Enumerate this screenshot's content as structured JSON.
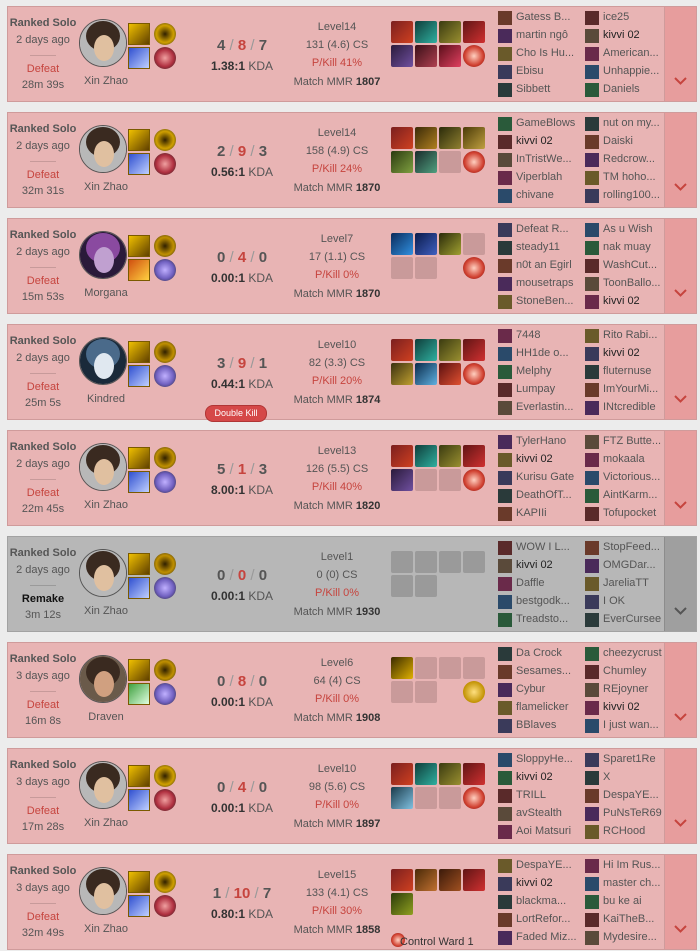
{
  "matches": [
    {
      "game_type": "Ranked Solo",
      "time_ago": "2 days ago",
      "result": "Defeat",
      "length": "28m 39s",
      "champion": "Xin Zhao",
      "portrait": "xin",
      "spells": [
        "smite-icon",
        "flash-icon"
      ],
      "runes": [
        "electrocute-rune-icon",
        "domination-rune-icon"
      ],
      "kda": {
        "k": "4",
        "d": "8",
        "a": "7"
      },
      "kda_ratio": "1.38:1",
      "level": "Level14",
      "cs": "131 (4.6) CS",
      "pkill": "P/Kill 41%",
      "mmr_label": "Match MMR",
      "mmr": "1807",
      "items": [
        "i1",
        "i2",
        "i3",
        "i4",
        "i5",
        "i6",
        "i7"
      ],
      "items_empty": 0,
      "ward": "red",
      "ward_label": "",
      "badge": "",
      "team1": [
        "Gatess B...",
        "martin ngô",
        "Cho Is Hu...",
        "Ebisu",
        "Sibbett"
      ],
      "team2": [
        "ice25",
        "kivvi 02",
        "American...",
        "Unhappie...",
        "Daniels"
      ],
      "me_team": 2,
      "me_index": 1
    },
    {
      "game_type": "Ranked Solo",
      "time_ago": "2 days ago",
      "result": "Defeat",
      "length": "32m 31s",
      "champion": "Xin Zhao",
      "portrait": "xin",
      "spells": [
        "smite-icon",
        "flash-icon"
      ],
      "runes": [
        "electrocute-rune-icon",
        "domination-rune-icon"
      ],
      "kda": {
        "k": "2",
        "d": "9",
        "a": "3"
      },
      "kda_ratio": "0.56:1",
      "level": "Level14",
      "cs": "158 (4.9) CS",
      "pkill": "P/Kill 24%",
      "mmr_label": "Match MMR",
      "mmr": "1870",
      "items": [
        "i1",
        "i8",
        "i9",
        "i10",
        "i11",
        "i12"
      ],
      "items_empty": 1,
      "ward": "red",
      "ward_label": "",
      "badge": "",
      "team1": [
        "GameBlows",
        "kivvi 02",
        "InTristWe...",
        "Viperblah",
        "chivane"
      ],
      "team2": [
        "nut on my...",
        "Daiski",
        "Redcrow...",
        "TM hoho...",
        "rolling100..."
      ],
      "me_team": 1,
      "me_index": 1
    },
    {
      "game_type": "Ranked Solo",
      "time_ago": "2 days ago",
      "result": "Defeat",
      "length": "15m 53s",
      "champion": "Morgana",
      "portrait": "morgana",
      "spells": [
        "smite-icon",
        "ignite-icon"
      ],
      "runes": [
        "aery-rune-icon",
        "sorcery-rune-icon"
      ],
      "kda": {
        "k": "0",
        "d": "4",
        "a": "0"
      },
      "kda_ratio": "0.00:1",
      "level": "Level7",
      "cs": "17 (1.1) CS",
      "pkill": "P/Kill 0%",
      "mmr_label": "Match MMR",
      "mmr": "1870",
      "items": [
        "i13",
        "i14",
        "i15"
      ],
      "items_empty": 3,
      "ward": "red",
      "ward_label": "",
      "badge": "",
      "team1": [
        "Defeat R...",
        "steady11",
        "n0t an Egirl",
        "mousetraps",
        "StoneBen..."
      ],
      "team2": [
        "As u Wish",
        "nak muay",
        "WashCut...",
        "ToonBallo...",
        "kivvi 02"
      ],
      "me_team": 2,
      "me_index": 4
    },
    {
      "game_type": "Ranked Solo",
      "time_ago": "2 days ago",
      "result": "Defeat",
      "length": "25m 5s",
      "champion": "Kindred",
      "portrait": "kindred",
      "spells": [
        "smite-icon",
        "flash-icon"
      ],
      "runes": [
        "aery-rune-icon",
        "sorcery-rune-icon"
      ],
      "kda": {
        "k": "3",
        "d": "9",
        "a": "1"
      },
      "kda_ratio": "0.44:1",
      "level": "Level10",
      "cs": "82 (3.3) CS",
      "pkill": "P/Kill 20%",
      "mmr_label": "Match MMR",
      "mmr": "1874",
      "items": [
        "i1",
        "i2",
        "i3",
        "i4",
        "i16",
        "i17",
        "i18"
      ],
      "items_empty": 0,
      "ward": "red",
      "ward_label": "",
      "badge": "Double Kill",
      "team1": [
        "7448",
        "HH1de o...",
        "Melphy",
        "Lumpay",
        "Everlastin..."
      ],
      "team2": [
        "Rito Rabi...",
        "kivvi 02",
        "fluternuse",
        "ImYourMi...",
        "INtcredible"
      ],
      "me_team": 2,
      "me_index": 1
    },
    {
      "game_type": "Ranked Solo",
      "time_ago": "2 days ago",
      "result": "Defeat",
      "length": "22m 45s",
      "champion": "Xin Zhao",
      "portrait": "xin",
      "spells": [
        "smite-icon",
        "flash-icon"
      ],
      "runes": [
        "aery-rune-icon",
        "sorcery-rune-icon"
      ],
      "kda": {
        "k": "5",
        "d": "1",
        "a": "3"
      },
      "kda_ratio": "8.00:1",
      "level": "Level13",
      "cs": "126 (5.5) CS",
      "pkill": "P/Kill 40%",
      "mmr_label": "Match MMR",
      "mmr": "1820",
      "items": [
        "i1",
        "i2",
        "i3",
        "i4",
        "i5"
      ],
      "items_empty": 2,
      "ward": "red",
      "ward_label": "",
      "badge": "",
      "team1": [
        "TylerHano",
        "kivvi 02",
        "Kurisu Gate",
        "DeathOfT...",
        "KAPIIi"
      ],
      "team2": [
        "FTZ Butte...",
        "mokaala",
        "Victorious...",
        "AintKarm...",
        "Tofupocket"
      ],
      "me_team": 1,
      "me_index": 1
    },
    {
      "game_type": "Ranked Solo",
      "time_ago": "2 days ago",
      "result": "Remake",
      "length": "3m 12s",
      "champion": "Xin Zhao",
      "portrait": "xin",
      "spells": [
        "smite-icon",
        "flash-icon"
      ],
      "runes": [
        "aery-rune-icon",
        "sorcery-rune-icon"
      ],
      "kda": {
        "k": "0",
        "d": "0",
        "a": "0"
      },
      "kda_ratio": "0.00:1",
      "level": "Level1",
      "cs": "0 (0) CS",
      "pkill": "P/Kill 0%",
      "mmr_label": "Match MMR",
      "mmr": "1930",
      "items": [],
      "items_empty": 6,
      "ward": "none",
      "ward_label": "",
      "badge": "",
      "team1": [
        "WOW I L...",
        "kivvi 02",
        "Daffle",
        "bestgodk...",
        "Treadsto..."
      ],
      "team2": [
        "StopFeed...",
        "OMGDar...",
        "JareliaTT",
        "I OK",
        "EverCursee"
      ],
      "me_team": 1,
      "me_index": 1
    },
    {
      "game_type": "Ranked Solo",
      "time_ago": "3 days ago",
      "result": "Defeat",
      "length": "16m 8s",
      "champion": "Draven",
      "portrait": "draven",
      "spells": [
        "smite-icon",
        "heal-icon"
      ],
      "runes": [
        "conqueror-rune-icon",
        "sorcery-rune-icon"
      ],
      "kda": {
        "k": "0",
        "d": "8",
        "a": "0"
      },
      "kda_ratio": "0.00:1",
      "level": "Level6",
      "cs": "64 (4) CS",
      "pkill": "P/Kill 0%",
      "mmr_label": "Match MMR",
      "mmr": "1908",
      "items": [
        "i19"
      ],
      "items_empty": 5,
      "ward": "yellow",
      "ward_label": "",
      "badge": "",
      "team1": [
        "Da Crock",
        "Sesames...",
        "Cybur",
        "flamelicker",
        "BBlaves"
      ],
      "team2": [
        "cheezycrust",
        "Chumley",
        "REjoyner",
        "kivvi 02",
        "I just wan..."
      ],
      "me_team": 2,
      "me_index": 3
    },
    {
      "game_type": "Ranked Solo",
      "time_ago": "3 days ago",
      "result": "Defeat",
      "length": "17m 28s",
      "champion": "Xin Zhao",
      "portrait": "xin",
      "spells": [
        "smite-icon",
        "flash-icon"
      ],
      "runes": [
        "electrocute-rune-icon",
        "domination-rune-icon"
      ],
      "kda": {
        "k": "0",
        "d": "4",
        "a": "0"
      },
      "kda_ratio": "0.00:1",
      "level": "Level10",
      "cs": "98 (5.6) CS",
      "pkill": "P/Kill 0%",
      "mmr_label": "Match MMR",
      "mmr": "1897",
      "items": [
        "i1",
        "i2",
        "i3",
        "i4",
        "i20"
      ],
      "items_empty": 2,
      "ward": "red",
      "ward_label": "",
      "badge": "",
      "team1": [
        "SloppyHe...",
        "kivvi 02",
        "TRILL",
        "avStealth",
        "Aoi Matsuri"
      ],
      "team2": [
        "Sparet1Re",
        "X",
        "DespaYE...",
        "PuNsTeR69",
        "RCHood"
      ],
      "me_team": 1,
      "me_index": 1
    },
    {
      "game_type": "Ranked Solo",
      "time_ago": "3 days ago",
      "result": "Defeat",
      "length": "32m 49s",
      "champion": "Xin Zhao",
      "portrait": "xin",
      "spells": [
        "smite-icon",
        "flash-icon"
      ],
      "runes": [
        "electrocute-rune-icon",
        "domination-rune-icon"
      ],
      "kda": {
        "k": "1",
        "d": "10",
        "a": "7"
      },
      "kda_ratio": "0.80:1",
      "level": "Level15",
      "cs": "133 (4.1) CS",
      "pkill": "P/Kill 30%",
      "mmr_label": "Match MMR",
      "mmr": "1858",
      "items": [
        "i1",
        "i21",
        "i22",
        "i4",
        "i23"
      ],
      "items_empty": 0,
      "ward": "control",
      "ward_label": "Control Ward 1",
      "badge": "",
      "team1": [
        "DespaYE...",
        "kivvi 02",
        "blackma...",
        "LortRefor...",
        "Faded Miz..."
      ],
      "team2": [
        "Hi Im Rus...",
        "master ch...",
        "bu ke ai",
        "KaiTheB...",
        "Mydesire..."
      ],
      "me_team": 1,
      "me_index": 1
    }
  ],
  "colors": {
    "defeat": "#c6443e",
    "defeat_bg": "#e8b4b4",
    "remake_bg": "#b7b7b7",
    "badge": "#d54848"
  }
}
